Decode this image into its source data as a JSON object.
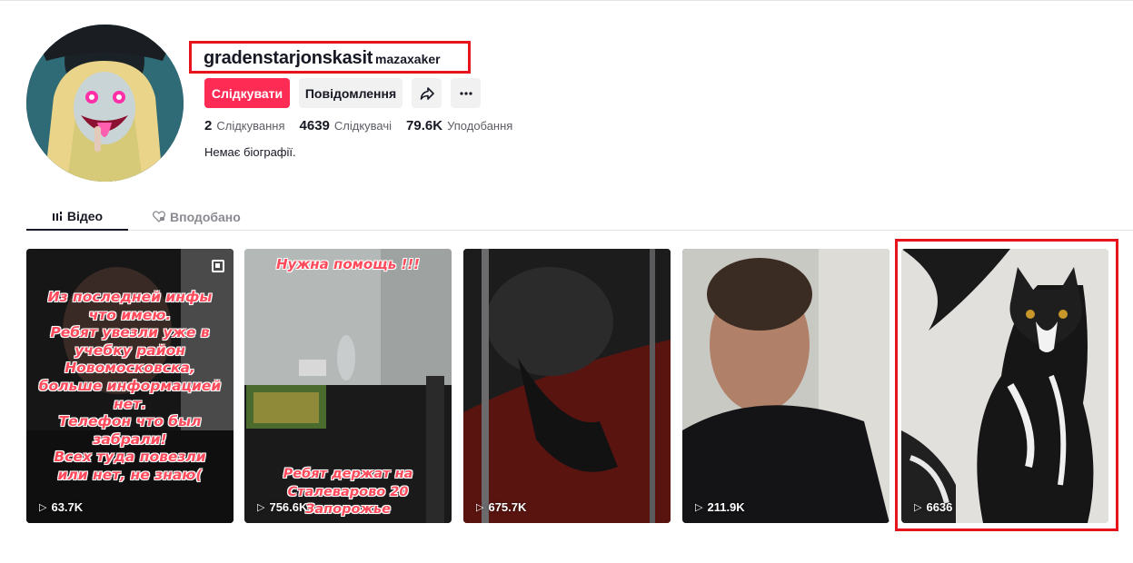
{
  "profile": {
    "username": "gradenstarjonskasit",
    "nickname": "mazaxaker",
    "buttons": {
      "follow": "Слідкувати",
      "message": "Повідомлення"
    },
    "stats": [
      {
        "value": "2",
        "label": "Слідкування"
      },
      {
        "value": "4639",
        "label": "Слідкувачі"
      },
      {
        "value": "79.6K",
        "label": "Уподобання"
      }
    ],
    "bio": "Немає біографії."
  },
  "tabs": [
    {
      "label": "Відео",
      "active": true
    },
    {
      "label": "Вподобано",
      "active": false
    }
  ],
  "videos": [
    {
      "views": "63.7K",
      "overlay_text": "Из последней инфы что имею. Ребят увезли уже в учебку район Новомосковска, больше информацией нет. Телефон что был забрали! Всех туда повезли или нет, не знаю(",
      "overlay_lines": [
        "Из последней инфы",
        "что имею.",
        "Ребят увезли уже в",
        "учебку район",
        "Новомосковска,",
        "больше информацией",
        "нет.",
        "Телефон что был",
        "забрали!",
        "Всех туда повезли",
        "или нет, не знаю("
      ]
    },
    {
      "views": "756.6K",
      "overlay_top": "Нужна помощь !!!",
      "overlay_bottom_lines": [
        "Ребят держат на",
        "Сталеварово 20",
        "Запорожье"
      ]
    },
    {
      "views": "675.7K"
    },
    {
      "views": "211.9K"
    },
    {
      "views": "6636"
    }
  ],
  "colors": {
    "follow_button": "#fe2c55",
    "highlight": "#e8141d",
    "overlay_text": "#ff4b5c"
  },
  "icons": [
    "share-icon",
    "more-icon",
    "grid-icon",
    "heart-lock-icon",
    "play-icon",
    "multi-photo-icon"
  ]
}
